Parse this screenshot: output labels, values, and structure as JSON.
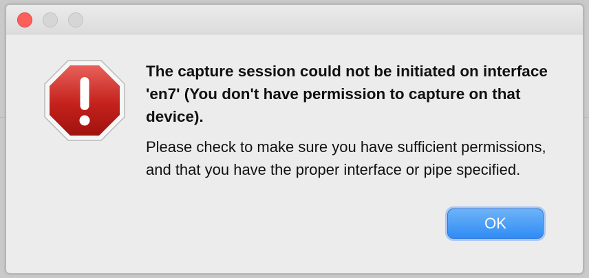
{
  "dialog": {
    "headline": "The capture session could not be initiated on interface 'en7' (You don't have permission to capture on that device).",
    "message": "Please check to make sure you have sufficient permissions, and that you have the proper interface or pipe specified.",
    "ok_label": "OK",
    "icon": "stop-alert-icon"
  },
  "colors": {
    "accent": "#2f8cf5",
    "stop_red": "#c4211c",
    "close_button": "#fc605b"
  }
}
